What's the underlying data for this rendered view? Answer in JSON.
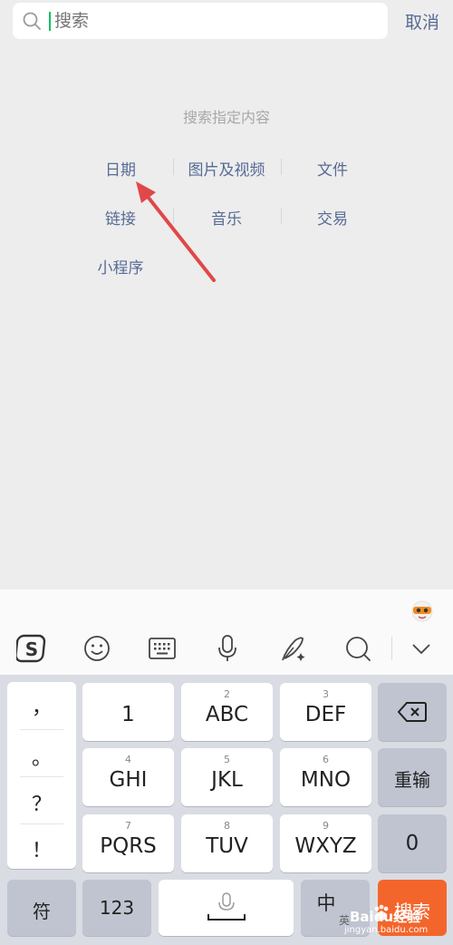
{
  "search": {
    "placeholder": "搜索",
    "cancel_label": "取消"
  },
  "filters": {
    "title": "搜索指定内容",
    "items": [
      "日期",
      "图片及视频",
      "文件",
      "链接",
      "音乐",
      "交易",
      "小程序"
    ]
  },
  "keyboard": {
    "toolbar_icons": [
      "sogou-logo-icon",
      "emoji-icon",
      "keyboard-icon",
      "microphone-icon",
      "handwriting-icon",
      "search-icon",
      "collapse-keyboard-icon"
    ],
    "punctuation": [
      "，",
      "。",
      "？",
      "！"
    ],
    "keys": [
      {
        "num": "",
        "label": "1"
      },
      {
        "num": "2",
        "label": "ABC"
      },
      {
        "num": "3",
        "label": "DEF"
      },
      {
        "num": "4",
        "label": "GHI"
      },
      {
        "num": "5",
        "label": "JKL"
      },
      {
        "num": "6",
        "label": "MNO"
      },
      {
        "num": "7",
        "label": "PQRS"
      },
      {
        "num": "8",
        "label": "TUV"
      },
      {
        "num": "9",
        "label": "WXYZ"
      }
    ],
    "reinput_label": "重输",
    "zero_label": "0",
    "symbol_label": "符",
    "numeric_label": "123",
    "lang_label": "中",
    "lang_sub": "英",
    "search_key_label": "搜索",
    "accent_color": "#f4652c"
  },
  "watermark": {
    "brand": "Baidu经验",
    "url": "jingyan.baidu.com"
  }
}
